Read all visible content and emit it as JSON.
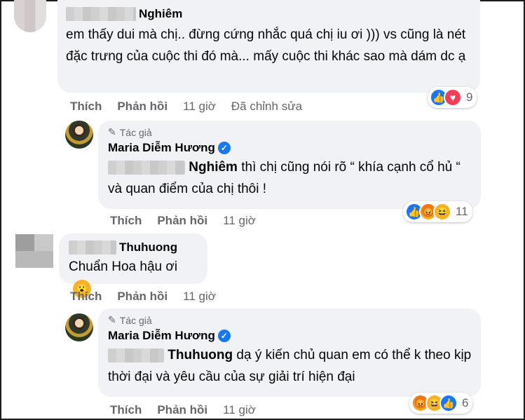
{
  "comments": [
    {
      "name_visible": "Nghiêm",
      "text": "em thấy dui mà chị.. đừng cứng nhắc quá chị iu ơi ))) vs cũng là nét đặc trưng của cuộc thi đó mà... mấy cuộc thi khác sao mà dám dc ạ",
      "actions": {
        "like": "Thích",
        "reply": "Phản hồi",
        "time": "11 giờ",
        "edited": "Đã chỉnh sửa"
      },
      "reactions": {
        "icons": [
          "like-icon",
          "love-icon"
        ],
        "count": "9"
      }
    },
    {
      "author_tag": "Tác giả",
      "name": "Maria Diễm Hương",
      "mention": "Nghiêm",
      "text": "thì chị cũng nói rõ “ khía cạnh cổ hủ “ và quan điểm của chị thôi !",
      "actions": {
        "like": "Thích",
        "reply": "Phản hồi",
        "time": "11 giờ"
      },
      "reactions": {
        "icons": [
          "like-icon",
          "angry-icon",
          "haha-icon"
        ],
        "count": "11"
      }
    },
    {
      "name_visible": "Thuhuong",
      "text": "Chuẩn Hoa hậu ơi",
      "emoji": "wow-icon",
      "actions": {
        "like": "Thích",
        "reply": "Phản hồi",
        "time": "11 giờ"
      }
    },
    {
      "author_tag": "Tác giả",
      "name": "Maria Diễm Hương",
      "mention": "Thuhuong",
      "text": "dạ ý kiến chủ quan em có thể k theo kịp thời đại và yêu cầu của sự giải trí hiện đại",
      "actions": {
        "like": "Thích",
        "reply": "Phản hồi",
        "time": "11 giờ"
      },
      "reactions": {
        "icons": [
          "angry-icon",
          "haha-icon",
          "like-icon"
        ],
        "count": "6"
      }
    }
  ],
  "colors": {
    "link_blue": "#1877f2",
    "bubble": "#f0f2f5",
    "meta_gray": "#65676b"
  }
}
